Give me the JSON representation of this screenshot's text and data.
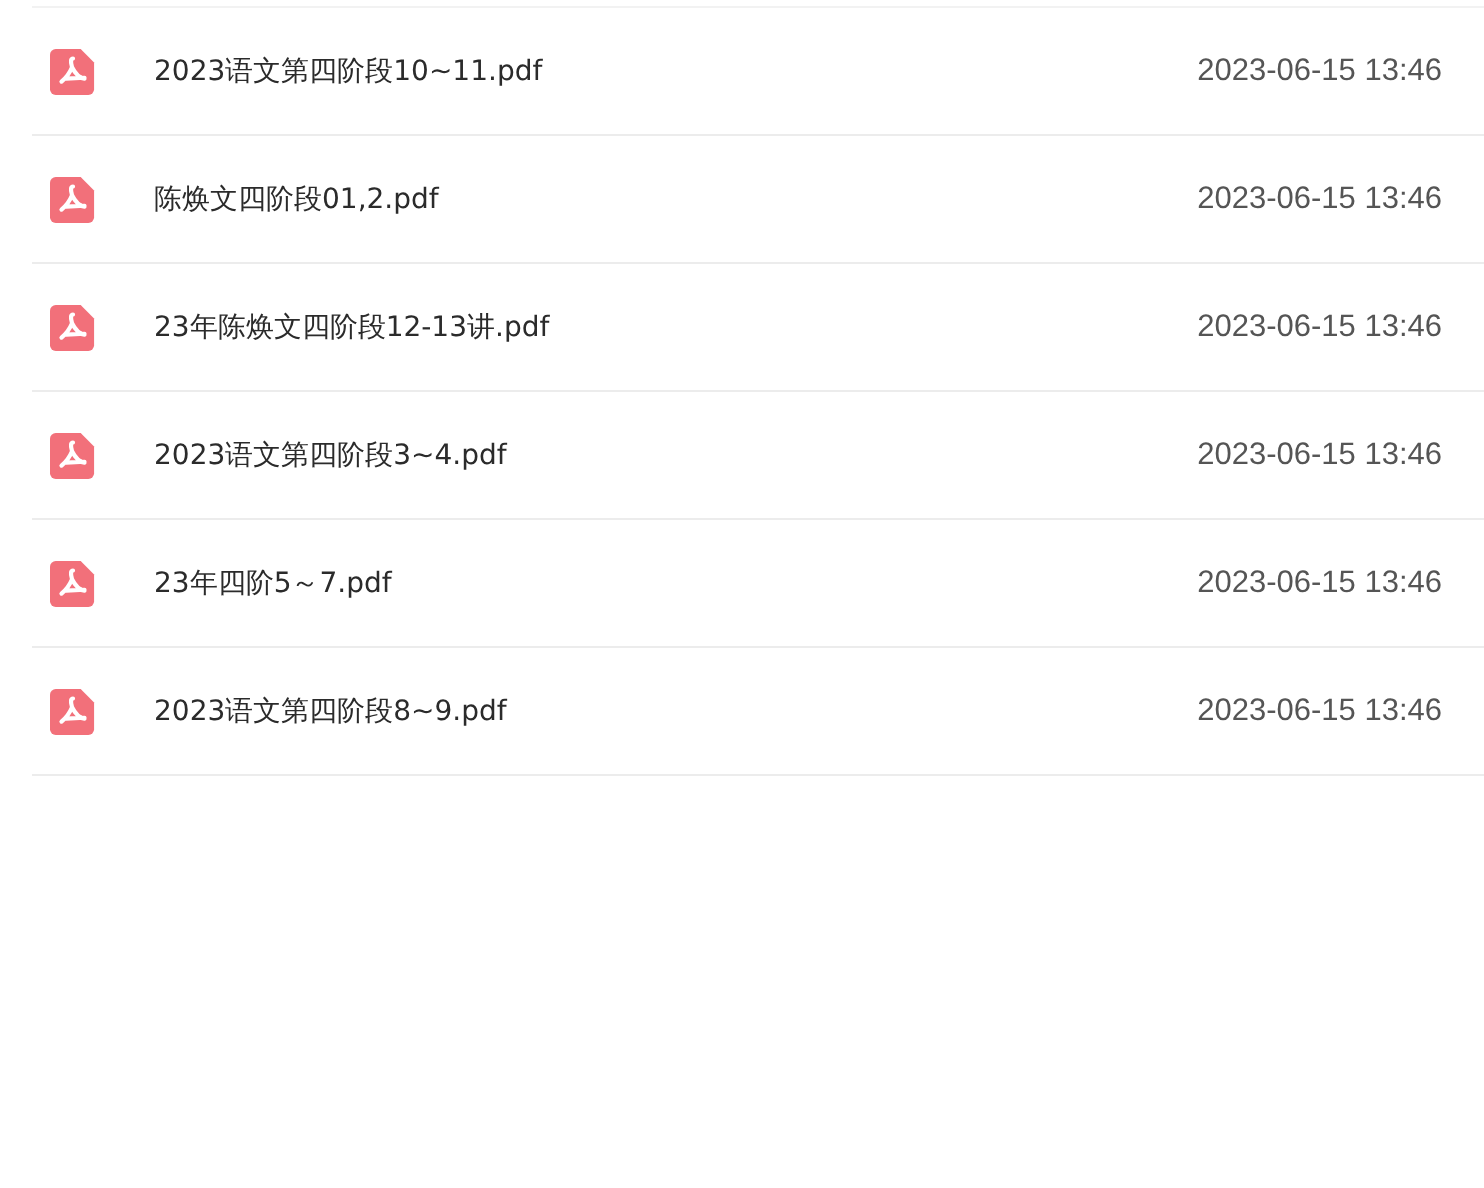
{
  "files": [
    {
      "name": "2023语文第四阶段10~11.pdf",
      "modified": "2023-06-15 13:46"
    },
    {
      "name": "陈焕文四阶段01,2.pdf",
      "modified": "2023-06-15 13:46"
    },
    {
      "name": "23年陈焕文四阶段12-13讲.pdf",
      "modified": "2023-06-15 13:46"
    },
    {
      "name": "2023语文第四阶段3~4.pdf",
      "modified": "2023-06-15 13:46"
    },
    {
      "name": "23年四阶5～7.pdf",
      "modified": "2023-06-15 13:46"
    },
    {
      "name": "2023语文第四阶段8~9.pdf",
      "modified": "2023-06-15 13:46"
    }
  ]
}
